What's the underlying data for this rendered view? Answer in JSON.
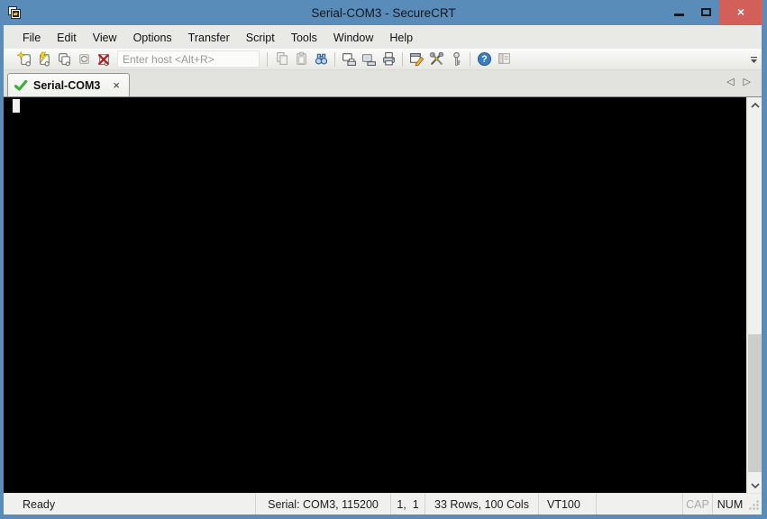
{
  "window": {
    "title": "Serial-COM3 - SecureCRT"
  },
  "menu": {
    "items": [
      {
        "label": "File"
      },
      {
        "label": "Edit"
      },
      {
        "label": "View"
      },
      {
        "label": "Options"
      },
      {
        "label": "Transfer"
      },
      {
        "label": "Script"
      },
      {
        "label": "Tools"
      },
      {
        "label": "Window"
      },
      {
        "label": "Help"
      }
    ]
  },
  "toolbar": {
    "host_placeholder": "Enter host <Alt+R>"
  },
  "tab": {
    "label": "Serial-COM3",
    "close_glyph": "×"
  },
  "tabbar": {
    "scroll_left_glyph": "◁",
    "scroll_right_glyph": "▷"
  },
  "icons": {
    "help_glyph": "?",
    "close_glyph": "×"
  },
  "terminal": {
    "cursor_row": 1,
    "cursor_col": 1
  },
  "statusbar": {
    "ready": "Ready",
    "connection": "Serial: COM3, 115200",
    "cursor_position": "1,  1",
    "grid_size": "33 Rows, 100 Cols",
    "emulation": "VT100",
    "caps_lock": "CAP",
    "num_lock": "NUM"
  },
  "colors": {
    "titlebar_blue": "#5a8cba",
    "close_button_red": "#d35f5b",
    "terminal_background": "#000000",
    "tab_check_green": "#3fae3f"
  }
}
